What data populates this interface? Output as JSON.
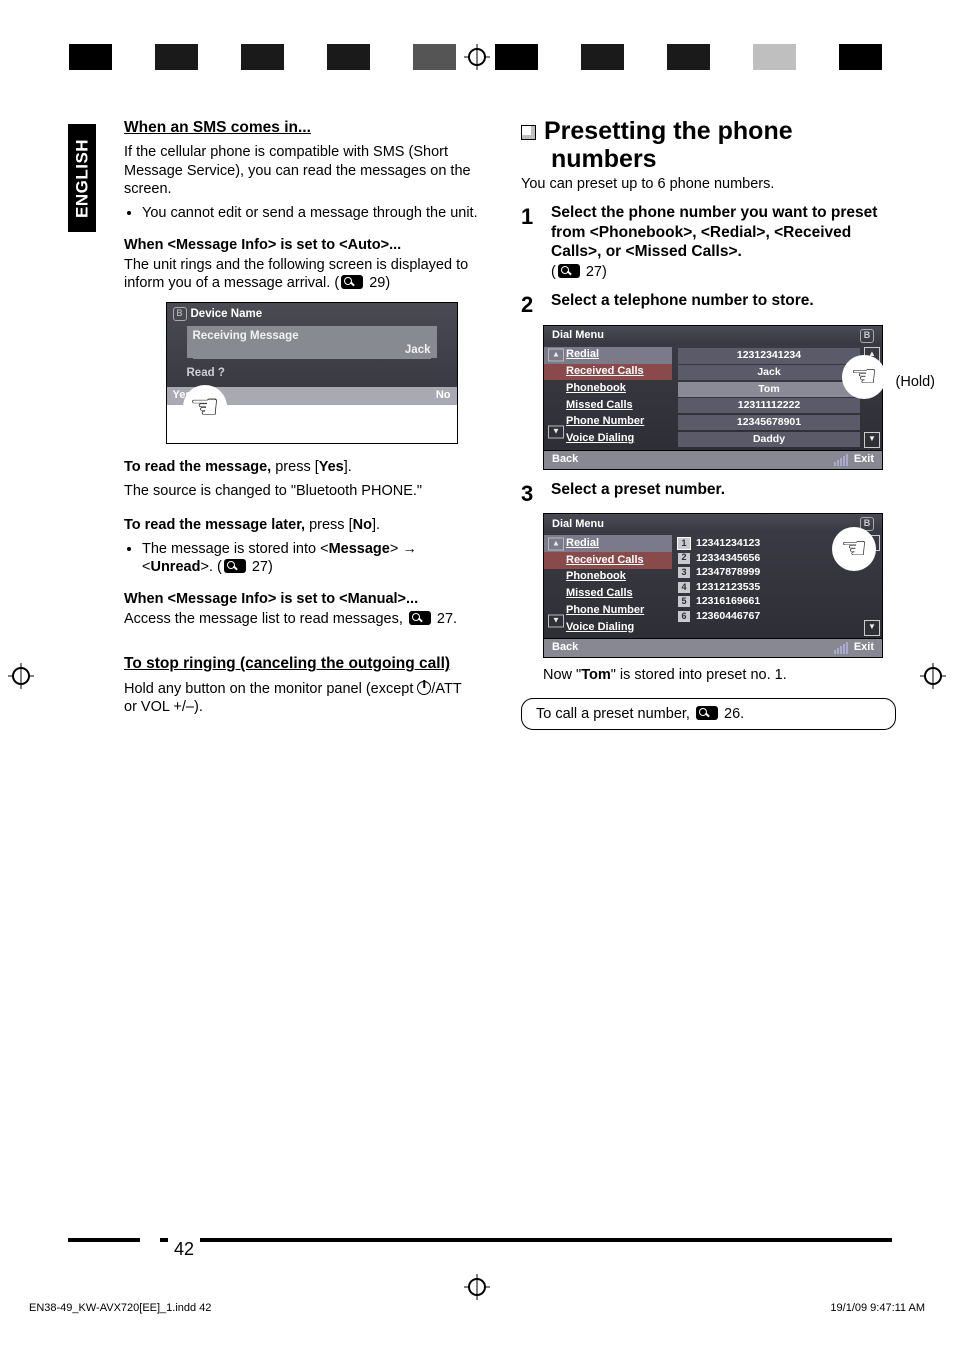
{
  "lang_tab": "ENGLISH",
  "page_number": "42",
  "footer": {
    "left": "EN38-49_KW-AVX720[EE]_1.indd   42",
    "right": "19/1/09   9:47:11 AM"
  },
  "left": {
    "h1": "When an SMS comes in...",
    "intro": "If the cellular phone is compatible with SMS (Short Message Service), you can read the messages on the screen.",
    "bullet1": "You cannot edit or send a message through the unit.",
    "auto_h": "When <Message Info> is set to <Auto>...",
    "auto_p1": "The unit rings and the following screen is displayed to inform you of a message arrival. (",
    "auto_p1_ref": " 29)",
    "screen": {
      "device": "Device Name",
      "recv": "Receiving Message",
      "name": "Jack",
      "read": "Read ?",
      "yes": "Yes",
      "no": "No"
    },
    "read_msg_b": "To read the message,",
    "read_msg_r": " press [",
    "read_msg_yes": "Yes",
    "read_msg_r2": "].",
    "read_src": "The source is changed to \"Bluetooth PHONE.\"",
    "later_b": "To read the message later,",
    "later_r": " press [",
    "later_no": "No",
    "later_r2": "].",
    "later_li1a": "The message is stored into <",
    "later_li1b": "Message",
    "later_li1c": "> ",
    "later_li2a": "<",
    "later_li2b": "Unread",
    "later_li2c": ">. (",
    "later_ref": " 27)",
    "manual_h": "When <Message Info> is set to <Manual>...",
    "manual_p": "Access the message list to read messages, ",
    "manual_ref": " 27.",
    "stop_h": "To stop ringing (canceling the outgoing call)",
    "stop_p1": "Hold any button on the monitor panel (except ",
    "stop_att": "/ATT",
    "stop_p2": "or VOL +/–)."
  },
  "right": {
    "title": "Presetting the phone numbers",
    "intro": "You can preset up to 6 phone numbers.",
    "step1_h": "Select the phone number you want to preset from <Phonebook>, <Redial>, <Received Calls>, or <Missed Calls>.",
    "step1_ref": " 27)",
    "step2_h": "Select a telephone number to store.",
    "hold": "(Hold)",
    "dial_title": "Dial Menu",
    "dial_items": [
      "Redial",
      "Received Calls",
      "Phonebook",
      "Missed Calls",
      "Phone Number",
      "Voice Dialing"
    ],
    "dial2_nums": [
      {
        "n": "",
        "v": "12312341234"
      },
      {
        "n": "",
        "v": "Jack"
      },
      {
        "n": "",
        "v": "Tom"
      },
      {
        "n": "",
        "v": "12311112222"
      },
      {
        "n": "",
        "v": "12345678901"
      },
      {
        "n": "",
        "v": "Daddy"
      }
    ],
    "dial_back": "Back",
    "dial_exit": "Exit",
    "step3_h": "Select a preset number.",
    "dial3_nums": [
      {
        "n": "1",
        "v": "12341234123"
      },
      {
        "n": "2",
        "v": "12334345656"
      },
      {
        "n": "3",
        "v": "12347878999"
      },
      {
        "n": "4",
        "v": "12312123535"
      },
      {
        "n": "5",
        "v": "12316169661"
      },
      {
        "n": "6",
        "v": "12360446767"
      }
    ],
    "now_a": "Now \"",
    "now_b": "Tom",
    "now_c": "\" is stored into preset no. 1.",
    "callbox_a": "To call a preset number, ",
    "callbox_ref": " 26."
  }
}
